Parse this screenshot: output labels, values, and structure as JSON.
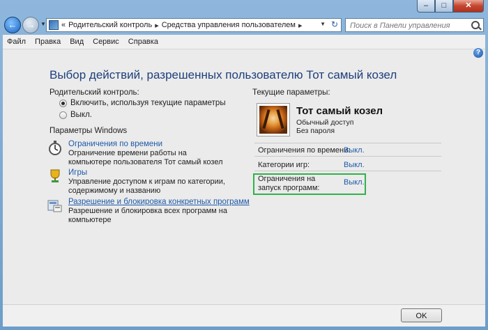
{
  "window": {
    "minimize": "–",
    "maximize": "□",
    "close": "✕"
  },
  "nav": {
    "back": "←",
    "forward": "→",
    "prefix": "«",
    "breadcrumb": [
      "Родительский контроль",
      "Средства управления пользователем"
    ],
    "search_placeholder": "Поиск в Панели управления"
  },
  "menu": [
    "Файл",
    "Правка",
    "Вид",
    "Сервис",
    "Справка"
  ],
  "page": {
    "title": "Выбор действий, разрешенных пользователю Тот самый козел",
    "parental_label": "Родительский контроль:",
    "radio_on": "Включить, используя текущие параметры",
    "radio_off": "Выкл.",
    "windows_settings_label": "Параметры Windows",
    "settings": [
      {
        "link": "Ограничения по времени",
        "desc": "Ограничение времени работы на компьютере пользователя Тот самый козел",
        "icon": "stopwatch-icon"
      },
      {
        "link": "Игры",
        "desc": "Управление доступом к играм по категории, содержимому и названию",
        "icon": "games-trophy-icon"
      },
      {
        "link": "Разрешение и блокировка конкретных программ",
        "desc": "Разрешение и блокировка всех программ на компьютере",
        "icon": "programs-icon"
      }
    ],
    "current_label": "Текущие параметры:",
    "user": {
      "name": "Тот самый козел",
      "account_type": "Обычный доступ",
      "password": "Без пароля"
    },
    "status_rows": [
      {
        "label": "Ограничения по времени:",
        "value": "Выкл."
      },
      {
        "label": "Категории игр:",
        "value": "Выкл."
      },
      {
        "label": "Ограничения на запуск программ:",
        "value": "Выкл."
      }
    ],
    "highlight_color": "#2fb24a"
  },
  "footer": {
    "ok_label": "OK"
  }
}
